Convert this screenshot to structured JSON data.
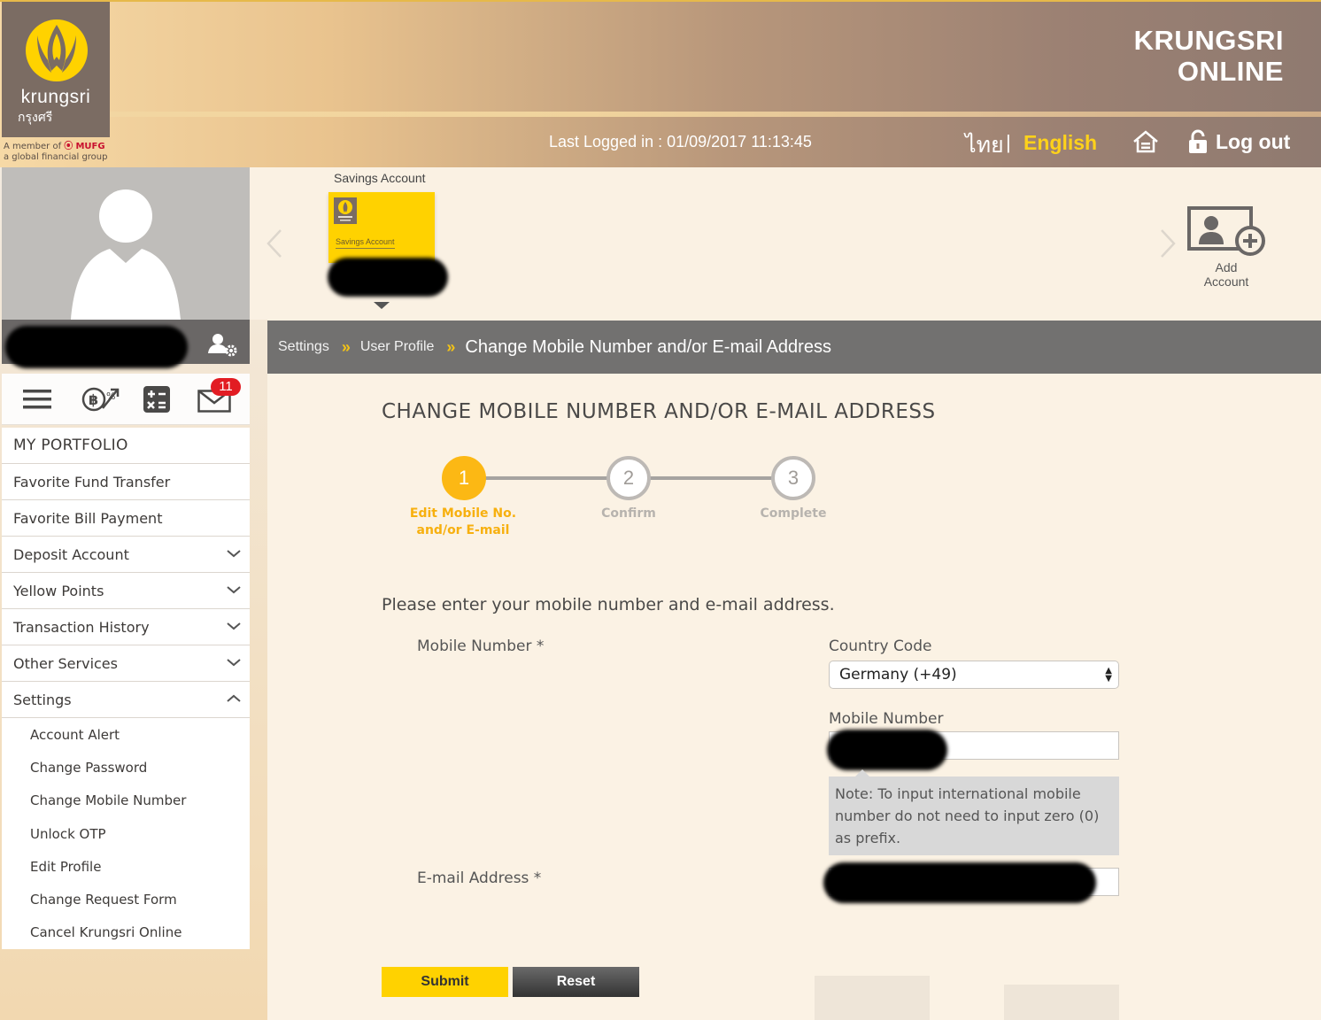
{
  "header": {
    "logo_name": "krungsri",
    "logo_thai": "กรุงศรี",
    "member_line1": "A member of",
    "member_brand": "MUFG",
    "member_line2": "a global financial group",
    "brand_line1": "KRUNGSRI",
    "brand_line2": "ONLINE",
    "last_logged_in": "Last Logged in : 01/09/2017 11:13:45",
    "lang_thai": "ไทย",
    "lang_separator": "|",
    "lang_english": "English",
    "logout_label": "Log out"
  },
  "sidebar": {
    "notification_count": "11",
    "menu": [
      {
        "label": "MY PORTFOLIO"
      },
      {
        "label": "Favorite Fund Transfer"
      },
      {
        "label": "Favorite Bill Payment"
      },
      {
        "label": "Deposit Account"
      },
      {
        "label": "Yellow Points"
      },
      {
        "label": "Transaction History"
      },
      {
        "label": "Other Services"
      },
      {
        "label": "Settings"
      }
    ],
    "settings_sub": [
      {
        "label": "Account Alert"
      },
      {
        "label": "Change Password"
      },
      {
        "label": "Change Mobile Number"
      },
      {
        "label": "Unlock OTP"
      },
      {
        "label": "Edit Profile"
      },
      {
        "label": "Change Request Form"
      },
      {
        "label": "Cancel Krungsri Online"
      }
    ]
  },
  "accounts": {
    "card_header": "Savings Account",
    "card_label": "Savings Account",
    "add_label_1": "Add",
    "add_label_2": "Account"
  },
  "breadcrumb": {
    "item1": "Settings",
    "item2": "User Profile",
    "current": "Change Mobile Number and/or E-mail Address",
    "separator": "»"
  },
  "main": {
    "title": "CHANGE MOBILE NUMBER AND/OR E-MAIL ADDRESS",
    "steps": [
      {
        "number": "1",
        "label_line1": "Edit Mobile No.",
        "label_line2": "and/or E-mail",
        "state": "active"
      },
      {
        "number": "2",
        "label_line1": "Confirm",
        "label_line2": "",
        "state": "pending"
      },
      {
        "number": "3",
        "label_line1": "Complete",
        "label_line2": "",
        "state": "pending"
      }
    ],
    "instruction": "Please enter your mobile number and e-mail address.",
    "mobile_label": "Mobile Number *",
    "country_code_label": "Country Code",
    "country_code_value": "Germany (+49)",
    "mobile_number_label": "Mobile Number",
    "note": "Note: To input international mobile number do not need to input zero (0) as prefix.",
    "email_label": "E-mail Address *",
    "submit_label": "Submit",
    "reset_label": "Reset"
  },
  "colors": {
    "accent_yellow": "#ffd200",
    "step_active": "#fcb814",
    "breadcrumb_bg": "#727170",
    "badge_red": "#e21c23"
  }
}
